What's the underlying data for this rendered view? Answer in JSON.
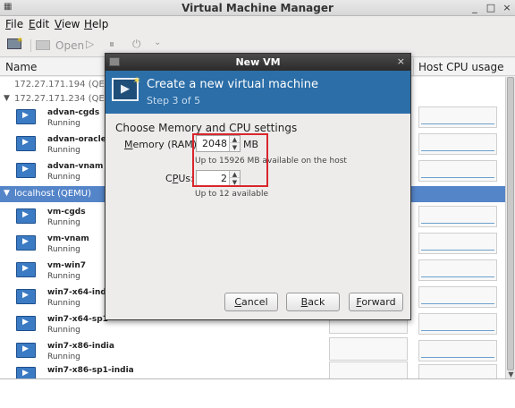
{
  "window": {
    "title": "Virtual Machine Manager",
    "controls": {
      "minimize": "_",
      "maximize": "□",
      "close": "×"
    }
  },
  "menu": {
    "file": {
      "accel": "F",
      "rest": "ile"
    },
    "edit": {
      "accel": "E",
      "rest": "dit"
    },
    "view": {
      "accel": "V",
      "rest": "iew"
    },
    "help": {
      "accel": "H",
      "rest": "elp"
    }
  },
  "toolbar": {
    "open_label": "Open",
    "icons": [
      "new-vm-icon",
      "open-icon",
      "run-icon",
      "pause-icon",
      "shutdown-icon",
      "dropdown-icon"
    ]
  },
  "columns": {
    "name": "Name",
    "cpu": "Host CPU usage"
  },
  "connections": [
    {
      "label": "172.27.171.194 (QEMU)",
      "expanded": false
    },
    {
      "label": "172.27.171.234 (QEMU)",
      "expanded": true
    },
    {
      "label": "localhost (QEMU)",
      "expanded": true,
      "selected": true
    }
  ],
  "vms": [
    {
      "name": "advan-cgds",
      "state": "Running"
    },
    {
      "name": "advan-oracle",
      "state": "Running"
    },
    {
      "name": "advan-vnam",
      "state": "Running"
    },
    {
      "name": "vm-cgds",
      "state": "Running"
    },
    {
      "name": "vm-vnam",
      "state": "Running"
    },
    {
      "name": "vm-win7",
      "state": "Running"
    },
    {
      "name": "win7-x64-indi",
      "state": "Running"
    },
    {
      "name": "win7-x64-sp1",
      "state": "Running"
    },
    {
      "name": "win7-x86-india",
      "state": "Running"
    },
    {
      "name": "win7-x86-sp1-india",
      "state": ""
    }
  ],
  "dialog": {
    "title": "New VM",
    "close": "×",
    "banner_title": "Create a new virtual machine",
    "banner_step": "Step 3 of 5",
    "heading": "Choose Memory and CPU settings",
    "memory": {
      "label_accel": "M",
      "label_rest": "emory (RAM):",
      "value": "2048",
      "unit": "MB",
      "hint": "Up to 15926 MB available on the host"
    },
    "cpus": {
      "label_pre": "C",
      "label_accel": "P",
      "label_rest": "Us:",
      "value": "2",
      "hint": "Up to 12 available"
    },
    "buttons": {
      "cancel": {
        "accel": "C",
        "rest": "ancel"
      },
      "back": {
        "accel": "B",
        "rest": "ack"
      },
      "forward": {
        "accel": "F",
        "rest": "orward"
      }
    }
  },
  "colors": {
    "banner": "#2b6ea8",
    "selection": "#5585c9",
    "highlight_box": "#d9262c"
  }
}
